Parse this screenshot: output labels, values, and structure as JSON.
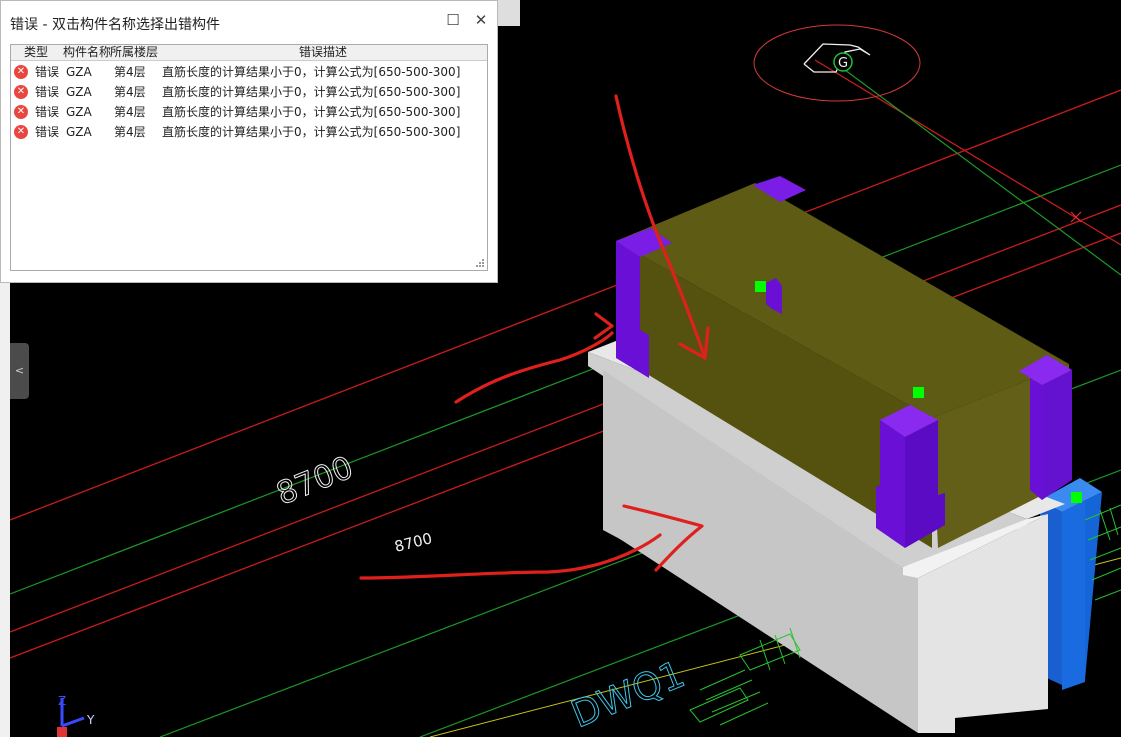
{
  "dialog": {
    "title": "错误 - 双击构件名称选择出错构件",
    "maximize_icon": "maximize-icon",
    "close_icon": "close-icon",
    "columns": [
      "类型",
      "构件名称",
      "所属楼层",
      "错误描述"
    ],
    "rows": [
      {
        "type": "错误",
        "component": "GZA",
        "floor": "第4层",
        "description": "直筋长度的计算结果小于0，计算公式为[650-500-300]"
      },
      {
        "type": "错误",
        "component": "GZA",
        "floor": "第4层",
        "description": "直筋长度的计算结果小于0，计算公式为[650-500-300]"
      },
      {
        "type": "错误",
        "component": "GZA",
        "floor": "第4层",
        "description": "直筋长度的计算结果小于0，计算公式为[650-500-300]"
      },
      {
        "type": "错误",
        "component": "GZA",
        "floor": "第4层",
        "description": "直筋长度的计算结果小于0，计算公式为[650-500-300]"
      }
    ]
  },
  "viewport": {
    "dimension_labels": [
      "8700",
      "8700"
    ],
    "wall_label": "DWQ1",
    "compass_label": "G",
    "axis_labels": {
      "z": "Z",
      "y": "Y"
    },
    "colors": {
      "background": "#000000",
      "beam": "#d9d9d9",
      "wall_top": "#5c5a15",
      "column": "#6a0fd6",
      "blue_column": "#1565d8",
      "grip_point": "#00ff00",
      "axis_red": "#d91f1f",
      "axis_green": "#1fa32a",
      "annotation_red": "#e0201c"
    }
  },
  "sidebar": {
    "collapse_icon": "chevron-left-icon"
  }
}
